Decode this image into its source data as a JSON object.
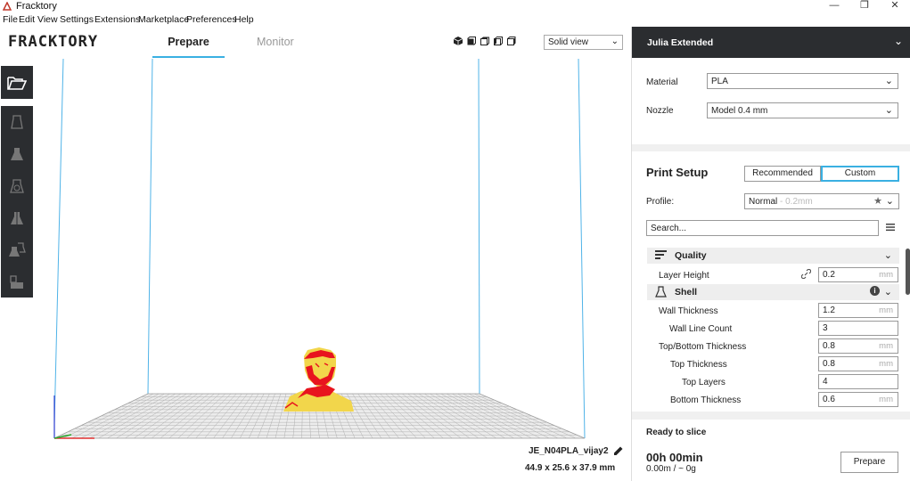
{
  "window": {
    "title": "Fracktory",
    "controls": {
      "minimize": "—",
      "maximize": "❐",
      "close": "✕"
    }
  },
  "menu": [
    "File",
    "Edit",
    "View",
    "Settings",
    "Extensions",
    "Marketplace",
    "Preferences",
    "Help"
  ],
  "header": {
    "logo": "FRACKTORY",
    "tabs": [
      {
        "label": "Prepare",
        "active": true
      },
      {
        "label": "Monitor",
        "active": false
      }
    ],
    "view_mode": "Solid view"
  },
  "viewport": {
    "model_name": "JE_N04PLA_vijay2",
    "model_dims": "44.9 x 25.6 x 37.9 mm"
  },
  "panel": {
    "printer_name": "Julia Extended",
    "material_label": "Material",
    "material_value": "PLA",
    "nozzle_label": "Nozzle",
    "nozzle_value": "Model 0.4 mm",
    "print_setup_title": "Print Setup",
    "mode_recommended": "Recommended",
    "mode_custom": "Custom",
    "profile_label": "Profile:",
    "profile_name": "Normal",
    "profile_suffix": " - 0.2mm",
    "search_placeholder": "Search...",
    "categories": {
      "quality": "Quality",
      "shell": "Shell"
    },
    "settings": [
      {
        "label": "Layer Height",
        "value": "0.2",
        "unit": "mm"
      },
      {
        "label": "Wall Thickness",
        "value": "1.2",
        "unit": "mm"
      },
      {
        "label": "Wall Line Count",
        "value": "3",
        "unit": ""
      },
      {
        "label": "Top/Bottom Thickness",
        "value": "0.8",
        "unit": "mm"
      },
      {
        "label": "Top Thickness",
        "value": "0.8",
        "unit": "mm"
      },
      {
        "label": "Top Layers",
        "value": "4",
        "unit": ""
      },
      {
        "label": "Bottom Thickness",
        "value": "0.6",
        "unit": "mm"
      }
    ]
  },
  "slice": {
    "title": "Ready to slice",
    "time": "00h 00min",
    "material": "0.00m / ~ 0g",
    "button": "Prepare"
  },
  "colors": {
    "accent": "#3ab0e2",
    "dark": "#2b2d30",
    "model_yellow": "#f2d64b",
    "model_red": "#e8141e"
  }
}
